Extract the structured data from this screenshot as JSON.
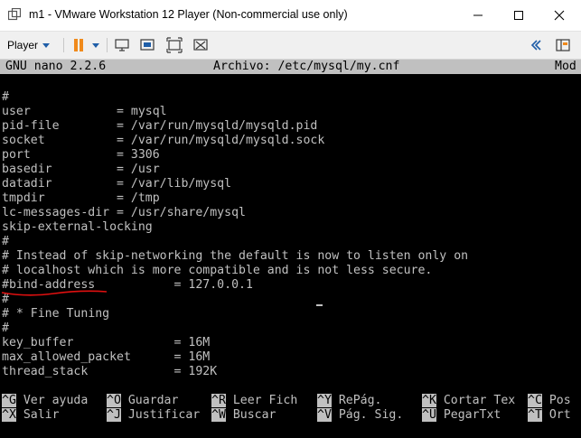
{
  "window": {
    "title": "m1 - VMware Workstation 12 Player (Non-commercial use only)"
  },
  "toolbar": {
    "player_label": "Player"
  },
  "nano": {
    "version": "GNU nano 2.2.6",
    "file_label": "Archivo: /etc/mysql/my.cnf",
    "status": "Mod"
  },
  "file_lines": [
    "#",
    "user            = mysql",
    "pid-file        = /var/run/mysqld/mysqld.pid",
    "socket          = /var/run/mysqld/mysqld.sock",
    "port            = 3306",
    "basedir         = /usr",
    "datadir         = /var/lib/mysql",
    "tmpdir          = /tmp",
    "lc-messages-dir = /usr/share/mysql",
    "skip-external-locking",
    "#",
    "# Instead of skip-networking the default is now to listen only on",
    "# localhost which is more compatible and is not less secure.",
    "#bind-address           = 127.0.0.1",
    "#",
    "# * Fine Tuning",
    "#",
    "key_buffer              = 16M",
    "max_allowed_packet      = 16M",
    "thread_stack            = 192K"
  ],
  "shortcuts_row1": [
    {
      "key": "^G",
      "label": "Ver ayuda"
    },
    {
      "key": "^O",
      "label": "Guardar"
    },
    {
      "key": "^R",
      "label": "Leer Fich"
    },
    {
      "key": "^Y",
      "label": "RePág."
    },
    {
      "key": "^K",
      "label": "Cortar Tex"
    },
    {
      "key": "^C",
      "label": "Pos"
    }
  ],
  "shortcuts_row2": [
    {
      "key": "^X",
      "label": "Salir"
    },
    {
      "key": "^J",
      "label": "Justificar"
    },
    {
      "key": "^W",
      "label": "Buscar"
    },
    {
      "key": "^V",
      "label": "Pág. Sig."
    },
    {
      "key": "^U",
      "label": "PegarTxt"
    },
    {
      "key": "^T",
      "label": "Ort"
    }
  ],
  "colors": {
    "annotation": "#e01010",
    "accent": "#1f5ea8",
    "pause": "#f08a1c"
  },
  "icons": [
    "vmware-icon",
    "minimize-icon",
    "maximize-icon",
    "close-icon",
    "pause-icon",
    "send-ctrl-alt-del-icon",
    "fit-guest-icon",
    "full-screen-icon",
    "unity-icon",
    "collapse-icon",
    "library-icon"
  ]
}
